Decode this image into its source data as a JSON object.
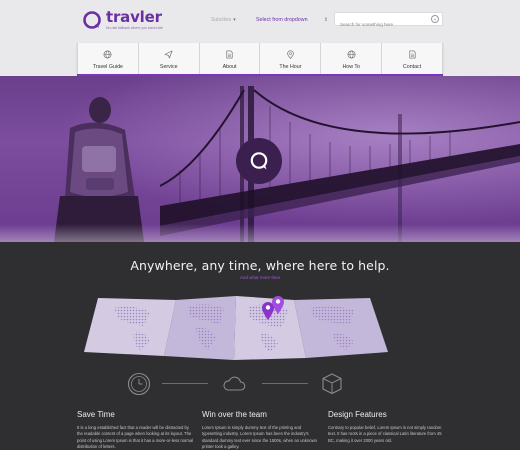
{
  "brand": {
    "name": "travler",
    "tagline": "No-risk fallback where you travel site"
  },
  "header": {
    "select_a": "Subcities",
    "select_a_caret": "▾",
    "select_b": "Select from dropdown",
    "select_b_caret": "⇕",
    "search_placeholder": "Search for something here"
  },
  "nav": {
    "items": [
      {
        "label": "Travel Guide",
        "icon": "globe-icon"
      },
      {
        "label": "Service",
        "icon": "paper-plane-icon"
      },
      {
        "label": "About",
        "icon": "document-icon"
      },
      {
        "label": "The Hour",
        "icon": "map-pin-icon"
      },
      {
        "label": "How To",
        "icon": "globe-icon"
      },
      {
        "label": "Contact",
        "icon": "document-icon"
      }
    ],
    "active_color": "#7c35c2"
  },
  "hero": {
    "badge_icon": "chat-bubble-icon"
  },
  "content": {
    "headline": "Anywhere, any time, where here to help.",
    "subline": "And what more then",
    "map_icon": "world-map-icon"
  },
  "features": [
    {
      "icon": "clock-icon",
      "title": "Save Time",
      "text": "It is a long established fact that a reader will be distracted by the readable content of a page when looking at its layout. The point of using Lorem Ipsum is that it has a more-or-less normal distribution of letters."
    },
    {
      "icon": "cloud-icon",
      "title": "Win over the team",
      "text": "Lorem Ipsum is simply dummy text of the printing and typesetting industry. Lorem Ipsum has been the industry's standard dummy text ever since the 1500s, when an unknown printer took a galley."
    },
    {
      "icon": "box-icon",
      "title": "Design Features",
      "text": "Contrary to popular belief, Lorem Ipsum is not simply random text. It has roots in a piece of classical Latin literature from 45 BC, making it over 2000 years old."
    }
  ],
  "colors": {
    "brand_purple": "#6a2fa3",
    "accent_purple": "#9a5cd6",
    "dark_bg": "#2f2f31"
  }
}
